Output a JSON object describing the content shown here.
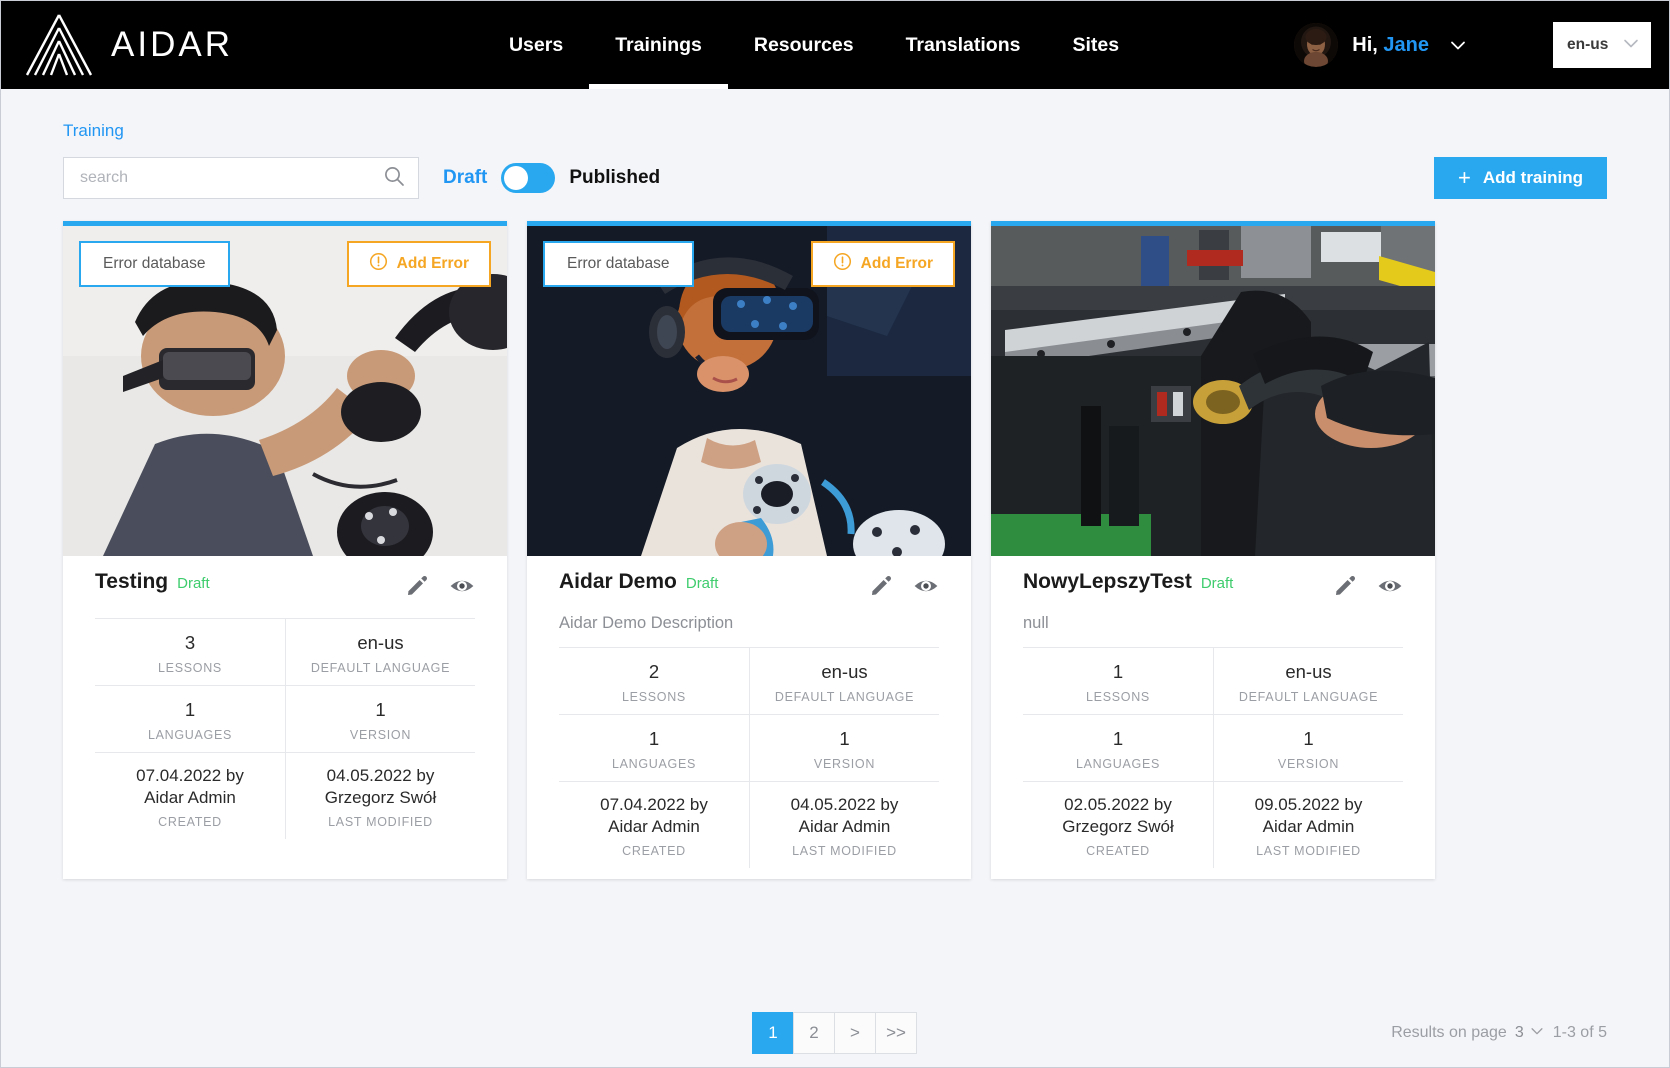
{
  "header": {
    "brand": "AIDAR",
    "logo_icon": "aidar-chevron-logo",
    "nav": [
      {
        "label": "Users",
        "active": false
      },
      {
        "label": "Trainings",
        "active": true
      },
      {
        "label": "Resources",
        "active": false
      },
      {
        "label": "Translations",
        "active": false
      },
      {
        "label": "Sites",
        "active": false
      }
    ],
    "greeting_prefix": "Hi,",
    "user_name": "Jane",
    "user_menu_icon": "chevron-down-icon",
    "avatar_icon": "user-avatar",
    "language": {
      "value": "en-us",
      "icon": "chevron-down-icon"
    },
    "accent_blue": "#2196f3",
    "background": "#000000"
  },
  "breadcrumb": "Training",
  "toolbar": {
    "search_placeholder": "search",
    "search_value": "",
    "search_icon": "search-icon",
    "toggle": {
      "left_label": "Draft",
      "right_label": "Published",
      "state": "draft",
      "track_color": "#29a8f0"
    },
    "add_button": {
      "label": "Add training",
      "icon": "plus-icon",
      "color": "#29a8f0"
    }
  },
  "cards": [
    {
      "error_db_label": "Error database",
      "add_error_label": "Add Error",
      "add_error_icon": "alert-circle-icon",
      "has_overlay_buttons": true,
      "image_alt": "man-wearing-vr-headset-with-controllers",
      "title": "Testing",
      "status": "Draft",
      "description": "",
      "has_description": false,
      "edit_icon": "pencil-icon",
      "preview_icon": "eye-icon",
      "stats": [
        [
          {
            "value": "3",
            "label": "LESSONS"
          },
          {
            "value": "en-us",
            "label": "DEFAULT LANGUAGE"
          }
        ],
        [
          {
            "value": "1",
            "label": "LANGUAGES"
          },
          {
            "value": "1",
            "label": "VERSION"
          }
        ],
        [
          {
            "value": "07.04.2022 by\nAidar Admin",
            "label": "CREATED"
          },
          {
            "value": "04.05.2022 by\nGrzegorz Swół",
            "label": "LAST MODIFIED"
          }
        ]
      ]
    },
    {
      "error_db_label": "Error database",
      "add_error_label": "Add Error",
      "add_error_icon": "alert-circle-icon",
      "has_overlay_buttons": true,
      "image_alt": "woman-wearing-vr-headset-dark-background",
      "title": "Aidar Demo",
      "status": "Draft",
      "description": "Aidar Demo Description",
      "has_description": true,
      "edit_icon": "pencil-icon",
      "preview_icon": "eye-icon",
      "stats": [
        [
          {
            "value": "2",
            "label": "LESSONS"
          },
          {
            "value": "en-us",
            "label": "DEFAULT LANGUAGE"
          }
        ],
        [
          {
            "value": "1",
            "label": "LANGUAGES"
          },
          {
            "value": "1",
            "label": "VERSION"
          }
        ],
        [
          {
            "value": "07.04.2022 by\nAidar Admin",
            "label": "CREATED"
          },
          {
            "value": "04.05.2022 by\nAidar Admin",
            "label": "LAST MODIFIED"
          }
        ]
      ]
    },
    {
      "error_db_label": "",
      "add_error_label": "",
      "add_error_icon": "",
      "has_overlay_buttons": false,
      "image_alt": "industrial-machine-operator-hands",
      "title": "NowyLepszyTest",
      "status": "Draft",
      "description": "null",
      "has_description": true,
      "edit_icon": "pencil-icon",
      "preview_icon": "eye-icon",
      "stats": [
        [
          {
            "value": "1",
            "label": "LESSONS"
          },
          {
            "value": "en-us",
            "label": "DEFAULT LANGUAGE"
          }
        ],
        [
          {
            "value": "1",
            "label": "LANGUAGES"
          },
          {
            "value": "1",
            "label": "VERSION"
          }
        ],
        [
          {
            "value": "02.05.2022 by\nGrzegorz Swół",
            "label": "CREATED"
          },
          {
            "value": "09.05.2022 by\nAidar Admin",
            "label": "LAST MODIFIED"
          }
        ]
      ]
    }
  ],
  "pagination": {
    "pages": [
      {
        "label": "1",
        "active": true
      },
      {
        "label": "2",
        "active": false
      },
      {
        "label": ">",
        "active": false
      },
      {
        "label": ">>",
        "active": false
      }
    ],
    "results_label": "Results on page",
    "results_per_page": "3",
    "results_icon": "chevron-down-icon",
    "range_text": "1-3 of 5"
  }
}
